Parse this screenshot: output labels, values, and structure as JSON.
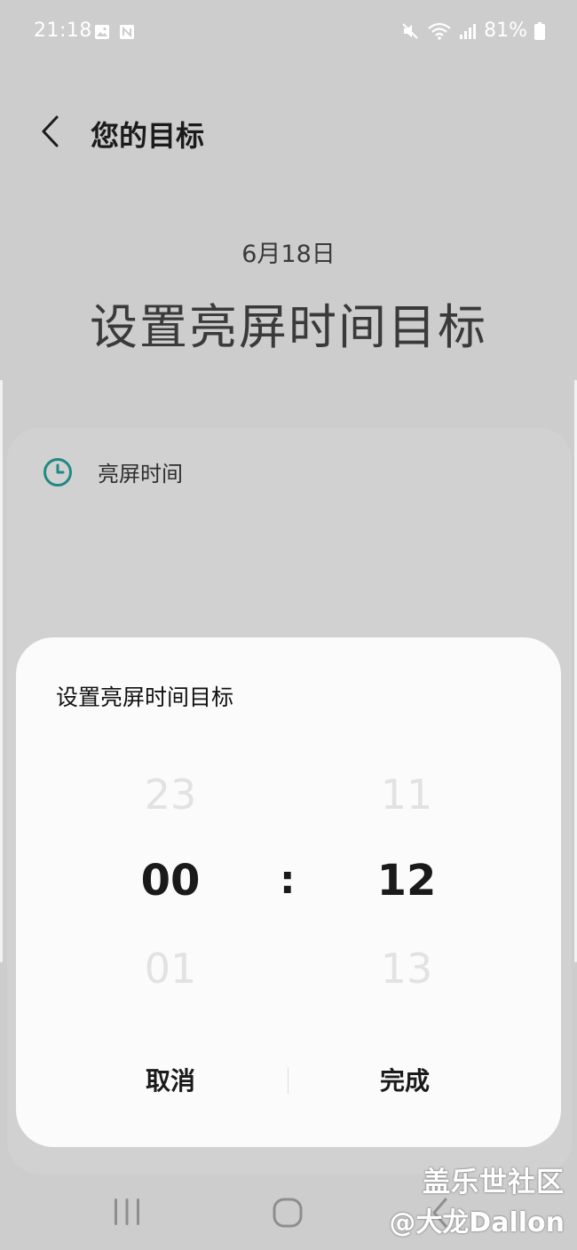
{
  "status_bar": {
    "time": "21:18",
    "battery": "81%"
  },
  "header": {
    "title": "您的目标"
  },
  "main": {
    "date": "6月18日",
    "title": "设置亮屏时间目标",
    "screen_time_label": "亮屏时间"
  },
  "dialog": {
    "title": "设置亮屏时间目标",
    "hours": {
      "prev": "23",
      "selected": "00",
      "next": "01"
    },
    "separator": ":",
    "minutes": {
      "prev": "11",
      "selected": "12",
      "next": "13"
    },
    "cancel_label": "取消",
    "done_label": "完成"
  },
  "watermark": {
    "line1": "盖乐世社区",
    "line2": "@大龙Dallon"
  },
  "colors": {
    "background": "#cdcdcd",
    "dialog": "#fbfbfb",
    "accent_teal": "#1f8a83"
  }
}
